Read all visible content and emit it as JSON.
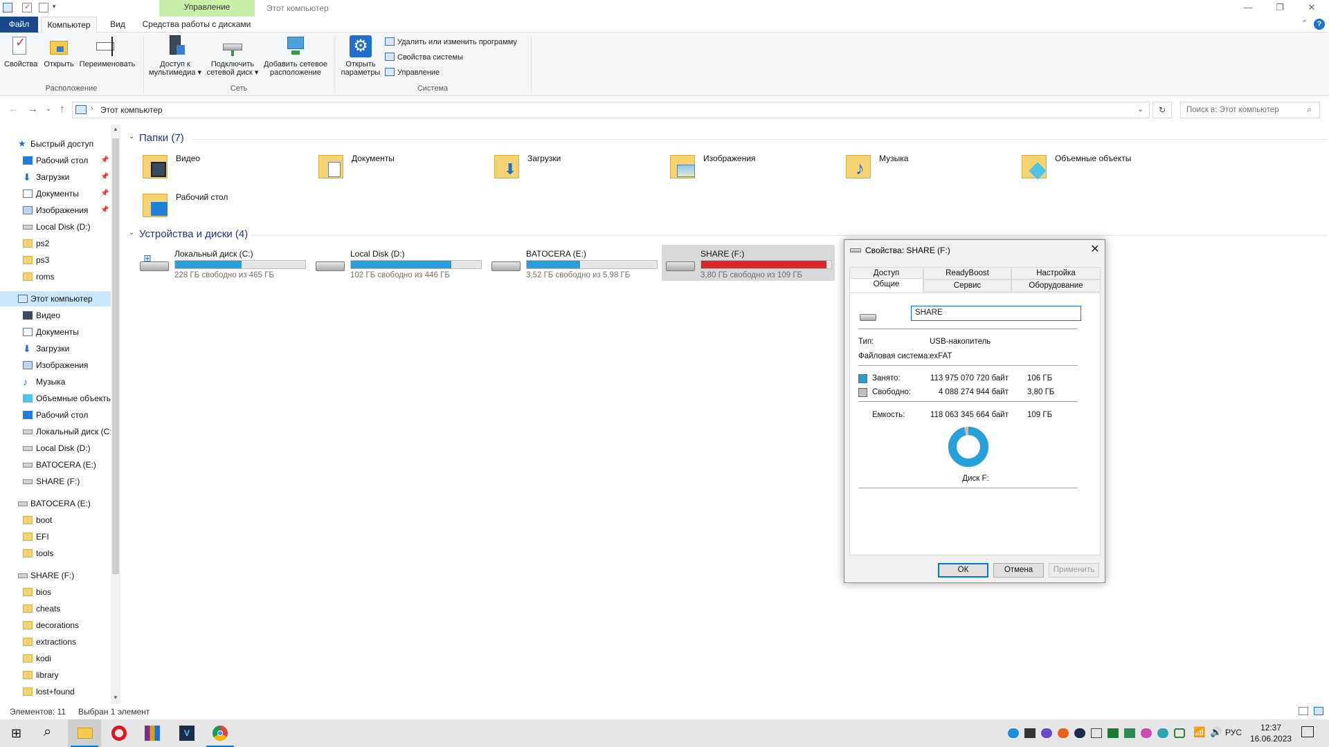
{
  "window": {
    "title": "Этот компьютер",
    "context_tab_group": "Управление"
  },
  "ribbon_tabs": [
    "Файл",
    "Компьютер",
    "Вид",
    "Средства работы с дисками"
  ],
  "ribbon": {
    "groups": {
      "location": "Расположение",
      "network": "Сеть",
      "system": "Система"
    },
    "buttons": {
      "properties": "Свойства",
      "open": "Открыть",
      "rename": "Переименовать",
      "media_1": "Доступ к",
      "media_2": "мультимедиа",
      "map_1": "Подключить",
      "map_2": "сетевой диск",
      "addnet_1": "Добавить сетевое",
      "addnet_2": "расположение",
      "settings_1": "Открыть",
      "settings_2": "параметры",
      "uninstall": "Удалить или изменить программу",
      "sysprops": "Свойства системы",
      "manage": "Управление"
    }
  },
  "address": {
    "path": "Этот компьютер",
    "search_placeholder": "Поиск в: Этот компьютер"
  },
  "nav": {
    "quick_access": "Быстрый доступ",
    "quick_items": [
      "Рабочий стол",
      "Загрузки",
      "Документы",
      "Изображения",
      "Local Disk (D:)",
      "ps2",
      "ps3",
      "roms"
    ],
    "this_pc": "Этот компьютер",
    "pc_items": [
      "Видео",
      "Документы",
      "Загрузки",
      "Изображения",
      "Музыка",
      "Объемные объекты",
      "Рабочий стол",
      "Локальный диск (C:)",
      "Local Disk (D:)",
      "BATOCERA (E:)",
      "SHARE (F:)"
    ],
    "batocera": "BATOCERA (E:)",
    "batocera_items": [
      "boot",
      "EFI",
      "tools"
    ],
    "share": "SHARE (F:)",
    "share_items": [
      "bios",
      "cheats",
      "decorations",
      "extractions",
      "kodi",
      "library",
      "lost+found"
    ]
  },
  "content": {
    "folders_header": "Папки (7)",
    "folders": [
      "Видео",
      "Документы",
      "Загрузки",
      "Изображения",
      "Музыка",
      "Объемные объекты",
      "Рабочий стол"
    ],
    "drives_header": "Устройства и диски (4)",
    "drives": [
      {
        "name": "Локальный диск (C:)",
        "free": "228 ГБ свободно из 465 ГБ",
        "used_fraction": 0.51
      },
      {
        "name": "Local Disk (D:)",
        "free": "102 ГБ свободно из 446 ГБ",
        "used_fraction": 0.77
      },
      {
        "name": "BATOCERA (E:)",
        "free": "3,52 ГБ свободно из 5,98 ГБ",
        "used_fraction": 0.41
      },
      {
        "name": "SHARE (F:)",
        "free": "3,80 ГБ свободно из 109 ГБ",
        "used_fraction": 0.965
      }
    ]
  },
  "status": {
    "count": "Элементов: 11",
    "selected": "Выбран 1 элемент"
  },
  "dialog": {
    "title": "Свойства: SHARE (F:)",
    "tabs_row1": [
      "Доступ",
      "ReadyBoost",
      "Настройка"
    ],
    "tabs_row2": [
      "Общие",
      "Сервис",
      "Оборудование"
    ],
    "label_value": "SHARE",
    "type_label": "Тип:",
    "type_value": "USB-накопитель",
    "fs_label": "Файловая система:",
    "fs_value": "exFAT",
    "used_label": "Занято:",
    "used_bytes": "113 975 070 720 байт",
    "used_size": "106 ГБ",
    "free_label": "Свободно:",
    "free_bytes": "4 088 274 944 байт",
    "free_size": "3,80 ГБ",
    "capacity_label": "Емкость:",
    "capacity_bytes": "118 063 345 664 байт",
    "capacity_size": "109 ГБ",
    "disk_label": "Диск F:",
    "used_fraction": 0.965,
    "ok": "ОК",
    "cancel": "Отмена",
    "apply": "Применить",
    "colors": {
      "used": "#26a0da",
      "free": "#bfbfbf"
    }
  },
  "taskbar": {
    "lang": "РУС",
    "time": "12:37",
    "date": "16.06.2023"
  },
  "colors": {
    "accent": "#0078d7",
    "file_tab": "#19478a",
    "context_tab": "#c9f0a8",
    "drive_bar": "#26a0da",
    "drive_bar_full": "#da2626",
    "selection": "#cce8ff"
  }
}
